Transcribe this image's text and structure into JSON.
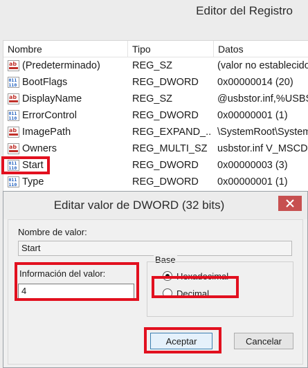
{
  "registry": {
    "title": "Editor del Registro",
    "columns": {
      "name": "Nombre",
      "type": "Tipo",
      "data": "Datos"
    },
    "rows": [
      {
        "icon": "string-value-icon",
        "name": "(Predeterminado)",
        "type": "REG_SZ",
        "data": "(valor no establecido)"
      },
      {
        "icon": "binary-value-icon",
        "name": "BootFlags",
        "type": "REG_DWORD",
        "data": "0x00000014 (20)"
      },
      {
        "icon": "string-value-icon",
        "name": "DisplayName",
        "type": "REG_SZ",
        "data": "@usbstor.inf,%USBST"
      },
      {
        "icon": "binary-value-icon",
        "name": "ErrorControl",
        "type": "REG_DWORD",
        "data": "0x00000001 (1)"
      },
      {
        "icon": "string-value-icon",
        "name": "ImagePath",
        "type": "REG_EXPAND_...",
        "data": "\\SystemRoot\\System"
      },
      {
        "icon": "string-value-icon",
        "name": "Owners",
        "type": "REG_MULTI_SZ",
        "data": "usbstor.inf V_MSCDS"
      },
      {
        "icon": "binary-value-icon",
        "name": "Start",
        "type": "REG_DWORD",
        "data": "0x00000003 (3)"
      },
      {
        "icon": "binary-value-icon",
        "name": "Type",
        "type": "REG_DWORD",
        "data": "0x00000001 (1)"
      }
    ]
  },
  "dialog": {
    "title": "Editar valor de DWORD (32 bits)",
    "name_label": "Nombre de valor:",
    "name_value": "Start",
    "value_label": "Información del valor:",
    "value_value": "4",
    "base_label": "Base",
    "hex_label": "Hexadecimal",
    "dec_label": "Decimal",
    "selected_base": "Hexadecimal",
    "ok_label": "Aceptar",
    "cancel_label": "Cancelar"
  },
  "colors": {
    "highlight": "#e2101f",
    "close": "#c75050"
  }
}
